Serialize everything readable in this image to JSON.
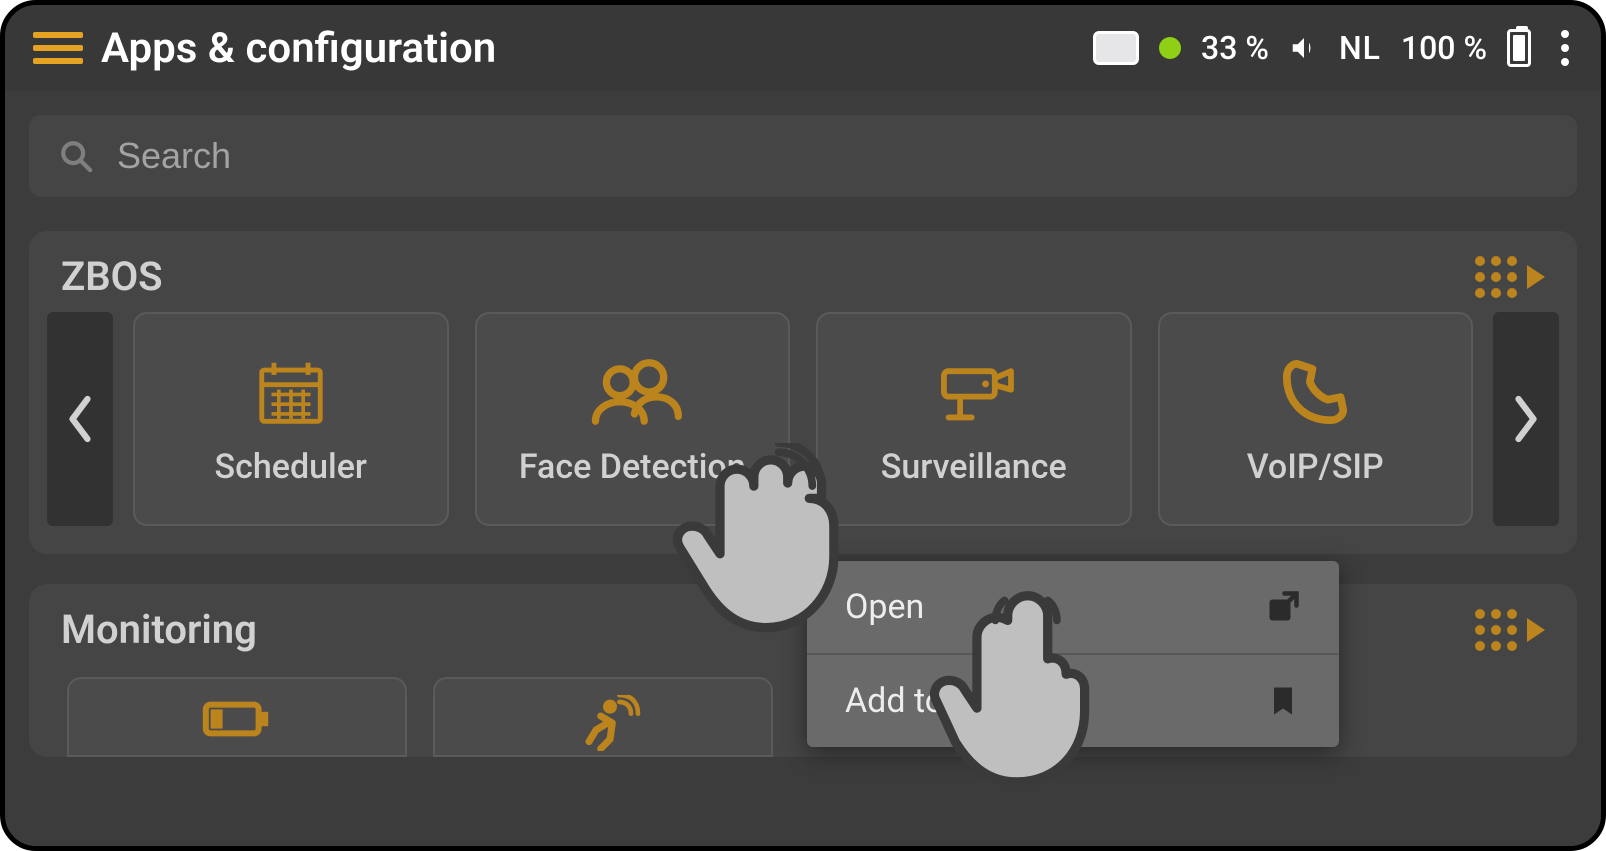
{
  "header": {
    "title": "Apps & configuration"
  },
  "status": {
    "brightness_pct": "33 %",
    "language": "NL",
    "battery_pct": "100 %"
  },
  "search": {
    "placeholder": "Search",
    "value": ""
  },
  "sections": [
    {
      "id": "zbos",
      "title": "ZBOS",
      "tiles": [
        {
          "id": "scheduler",
          "label": "Scheduler",
          "icon": "calendar-icon"
        },
        {
          "id": "face-detection",
          "label": "Face Detection",
          "icon": "people-icon"
        },
        {
          "id": "surveillance",
          "label": "Surveillance",
          "icon": "camera-icon"
        },
        {
          "id": "voip-sip",
          "label": "VoIP/SIP",
          "icon": "phone-icon"
        }
      ]
    },
    {
      "id": "monitoring",
      "title": "Monitoring",
      "tiles": [
        {
          "id": "mon-a",
          "label": "",
          "icon": "battery-low-icon"
        },
        {
          "id": "mon-b",
          "label": "",
          "icon": "motion-icon"
        }
      ]
    }
  ],
  "context_menu": {
    "items": [
      {
        "id": "open",
        "label": "Open",
        "icon": "open-external-icon"
      },
      {
        "id": "add-sidebar",
        "label": "Add to sidebar",
        "icon": "bookmark-icon"
      }
    ]
  },
  "colors": {
    "accent": "#e6a223",
    "bg_dark": "#383838",
    "bg_panel": "#555555",
    "status_green": "#8fd016"
  }
}
